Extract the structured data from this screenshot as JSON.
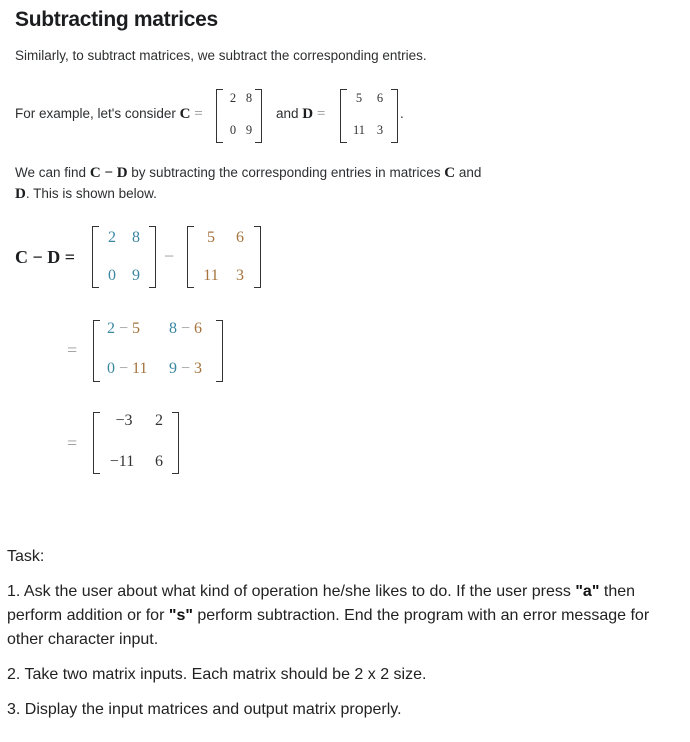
{
  "title": "Subtracting matrices",
  "intro": "Similarly, to subtract matrices, we subtract the corresponding entries.",
  "example": {
    "prefix": "For example, let's consider",
    "var_c": "C",
    "equals": "=",
    "connector": "and",
    "var_d": "D",
    "suffix": ".",
    "matrix_c": [
      [
        "2",
        "8"
      ],
      [
        "0",
        "9"
      ]
    ],
    "matrix_d": [
      [
        "5",
        "6"
      ],
      [
        "11",
        "3"
      ]
    ]
  },
  "explain": {
    "line1_pre": "We can find",
    "expr": "C − D",
    "line1_post": "by subtracting the corresponding entries in matrices",
    "var_c": "C",
    "line1_end": "and",
    "var_d": "D",
    "line2": ". This is shown below."
  },
  "derivation": {
    "lhs": "C − D =",
    "minus": "−",
    "equals": "=",
    "step1_c": [
      [
        "2",
        "8"
      ],
      [
        "0",
        "9"
      ]
    ],
    "step1_d": [
      [
        "5",
        "6"
      ],
      [
        "11",
        "3"
      ]
    ],
    "step2": [
      [
        {
          "a": "2",
          "b": "5"
        },
        {
          "a": "8",
          "b": "6"
        }
      ],
      [
        {
          "a": "0",
          "b": "11"
        },
        {
          "a": "9",
          "b": "3"
        }
      ]
    ],
    "result": [
      [
        "−3",
        "2"
      ],
      [
        "−11",
        "6"
      ]
    ]
  },
  "task": {
    "heading": "Task:",
    "item1_a": "1. Ask the user about what kind of operation he/she likes to do. If the user press ",
    "item1_key_a": "\"a\"",
    "item1_b": " then",
    "item1_c": "perform addition or for ",
    "item1_key_s": "\"s\"",
    "item1_d": " perform subtraction. End the program with an error message for",
    "item1_e": "other character input.",
    "item2": "2. Take two matrix inputs. Each matrix should be 2 x 2 size.",
    "item3": "3. Display the input matrices and output matrix properly."
  },
  "colors": {
    "matrix_c_entries": "#3a87a0",
    "matrix_d_entries": "#a5733d"
  }
}
